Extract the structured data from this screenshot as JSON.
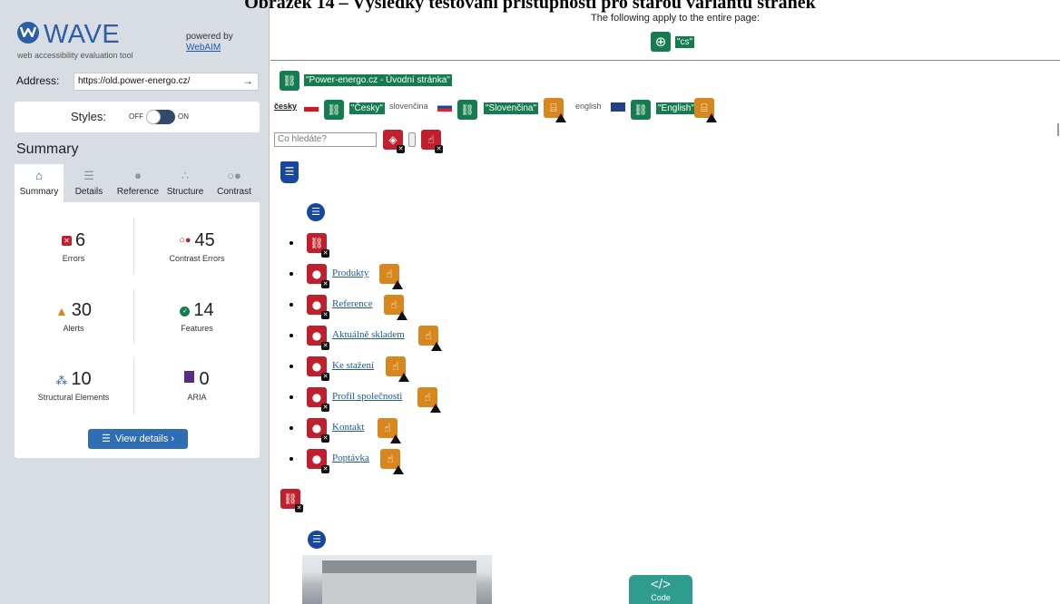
{
  "caption": "Obrázek 14 – Výsledky testování přístupnosti pro starou variantu stránek",
  "colors": {
    "brand": "#2b5ea7",
    "error": "#c0202e",
    "alert": "#d8871e",
    "feature": "#157c4f",
    "structure": "#17479e"
  },
  "sidebar": {
    "logo_word": "WAVE",
    "logo_sub": "web accessibility evaluation tool",
    "powered_by": "powered by",
    "webaim": "WebAIM",
    "address_label": "Address:",
    "address_value": "https://old.power-energo.cz/",
    "styles_label": "Styles:",
    "styles_off": "OFF",
    "styles_on": "ON",
    "summary_heading": "Summary",
    "tabs": [
      {
        "label": "Summary",
        "icon": "home-icon"
      },
      {
        "label": "Details",
        "icon": "list-icon"
      },
      {
        "label": "Reference",
        "icon": "info-icon"
      },
      {
        "label": "Structure",
        "icon": "structure-icon"
      },
      {
        "label": "Contrast",
        "icon": "contrast-icon"
      }
    ],
    "stats": {
      "errors": {
        "value": "6",
        "label": "Errors"
      },
      "contrast": {
        "value": "45",
        "label": "Contrast Errors"
      },
      "alerts": {
        "value": "30",
        "label": "Alerts"
      },
      "features": {
        "value": "14",
        "label": "Features"
      },
      "structural": {
        "value": "10",
        "label": "Structural Elements"
      },
      "aria": {
        "value": "0",
        "label": "ARIA"
      }
    },
    "view_details": "View details ›"
  },
  "main": {
    "top_note": "The following apply to the entire page:",
    "lang_tag": "\"cs\"",
    "title_tag": "\"Power-energo.cz - Úvodní stránka\"",
    "langs": {
      "cesky": "česky",
      "cesky_tag": "\"Česky\"",
      "slovencina": "slovenčina",
      "slovencina_tag": "\"Slovenčina\"",
      "english": "english",
      "english_tag": "\"English\""
    },
    "search_placeholder": "Co hledáte?",
    "nav_items": [
      "Produkty",
      "Reference",
      "Aktuálně skladem",
      "Ke stažení",
      "Profil společnosti",
      "Kontakt",
      "Poptávka"
    ],
    "code_button": "Code"
  }
}
